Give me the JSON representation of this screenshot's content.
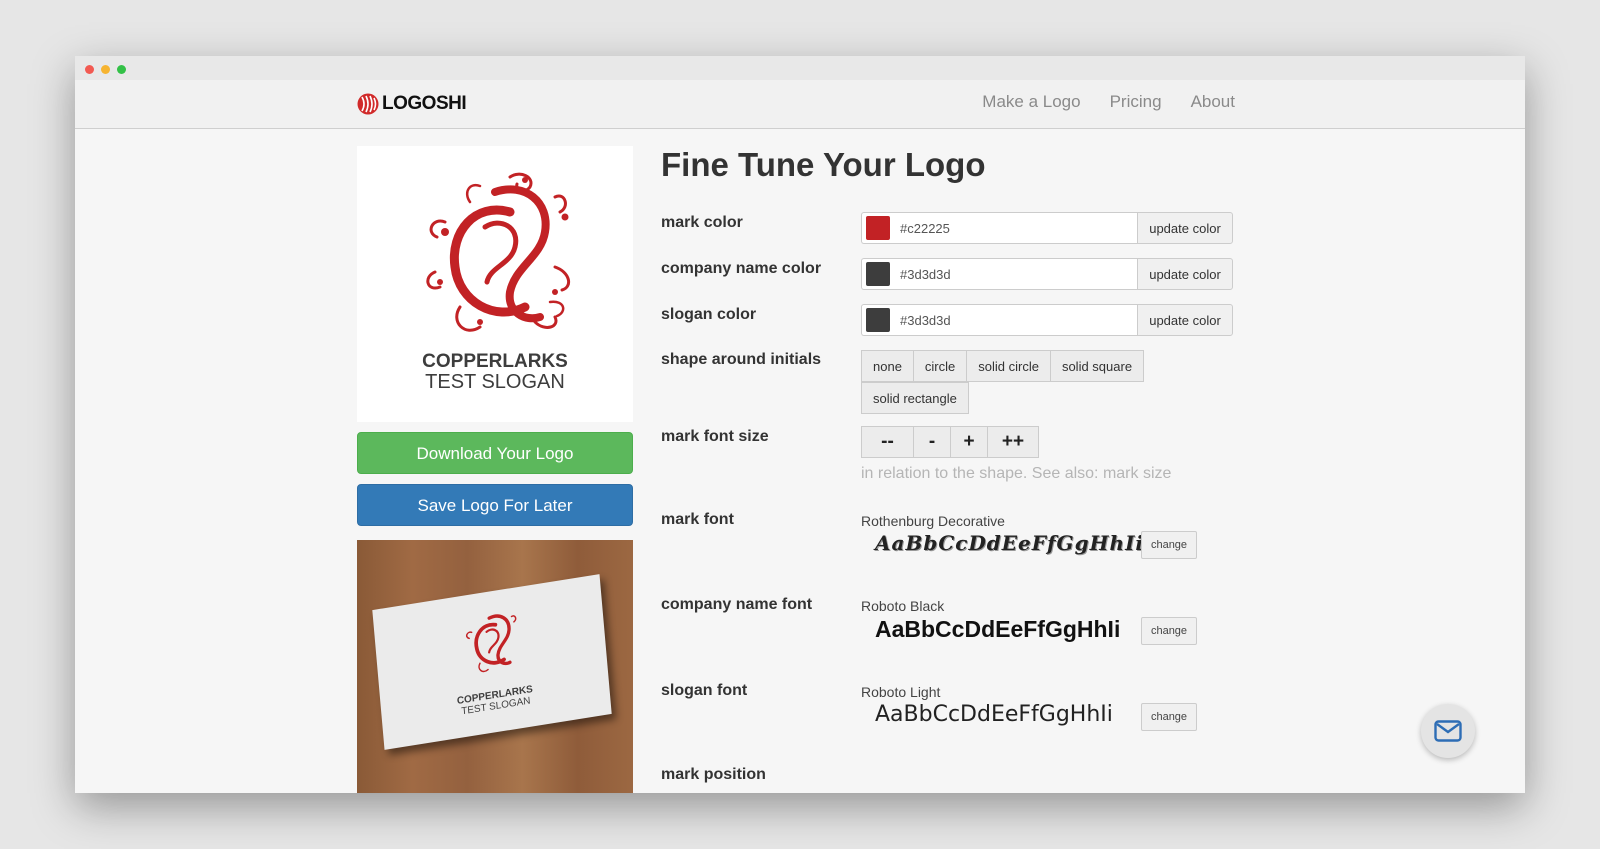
{
  "app": {
    "brand": "LOGOSHI",
    "nav": [
      "Make a Logo",
      "Pricing",
      "About"
    ]
  },
  "preview": {
    "company": "COPPERLARKS",
    "slogan": "TEST SLOGAN",
    "download_label": "Download Your Logo",
    "save_label": "Save Logo For Later"
  },
  "editor": {
    "title": "Fine Tune Your Logo",
    "colors": [
      {
        "label": "mark color",
        "value": "#c22225",
        "swatch": "#c22225",
        "button": "update color"
      },
      {
        "label": "company name color",
        "value": "#3d3d3d",
        "swatch": "#3d3d3d",
        "button": "update color"
      },
      {
        "label": "slogan color",
        "value": "#3d3d3d",
        "swatch": "#3d3d3d",
        "button": "update color"
      }
    ],
    "shape": {
      "label": "shape around initials",
      "options": [
        "none",
        "circle",
        "solid circle",
        "solid square",
        "solid rectangle"
      ]
    },
    "mark_font_size": {
      "label": "mark font size",
      "options": [
        "--",
        "-",
        "+",
        "++"
      ],
      "help": "in relation to the shape. See also: mark size"
    },
    "fonts": [
      {
        "label": "mark font",
        "name": "Rothenburg Decorative",
        "sample": "AaBbCcDdEeFfGgHhIi",
        "button": "change"
      },
      {
        "label": "company name font",
        "name": "Roboto Black",
        "sample": "AaBbCcDdEeFfGgHhIi",
        "button": "change"
      },
      {
        "label": "slogan font",
        "name": "Roboto Light",
        "sample": "AaBbCcDdEeFfGgHhIi",
        "button": "change"
      }
    ],
    "mark_position_label": "mark position"
  },
  "colors": {
    "mark": "#c22225",
    "text": "#3d3d3d",
    "green": "#5cb85c",
    "blue": "#337ab7"
  }
}
